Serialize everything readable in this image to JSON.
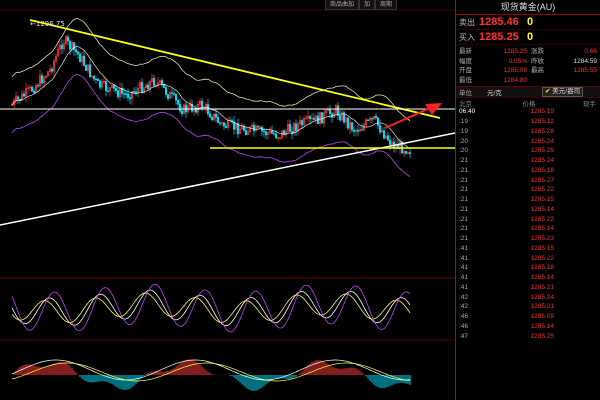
{
  "toolbar": {
    "btn1": "商品曲加",
    "btn2": "加",
    "btn3": "周期"
  },
  "chart": {
    "high_label": "1296.75",
    "colors": {
      "up": "#ff3b3b",
      "down": "#00e0ff",
      "resistance": "#ffff00",
      "support": "#ffffff",
      "arrow": "#ff2020",
      "bb": "#e0e0a0",
      "bb_mid": "#ffffff",
      "bb_low": "#c040ff"
    }
  },
  "panel": {
    "title": "现货黄金(AU)",
    "sell_label": "卖出",
    "sell_price": "1285.46",
    "sell_qty": "0",
    "buy_label": "买入",
    "buy_price": "1285.25",
    "buy_qty": "0",
    "stats": [
      {
        "k": "最新",
        "v": "1285.25",
        "k2": "涨跌",
        "v2": "0.66"
      },
      {
        "k": "幅度",
        "v": "0.05%",
        "k2": "昨收",
        "v2": "1284.59"
      },
      {
        "k": "开盘",
        "v": "1285.08",
        "k2": "最高",
        "v2": "1285.55"
      },
      {
        "k": "最低",
        "v": "1284.80",
        "k2": "",
        "v2": ""
      }
    ],
    "unit_label": "单位",
    "unit_value": "元/克",
    "unit_toggle": "美元/盎司",
    "col_time": "北京",
    "col_price": "价格",
    "col_vol": "现手",
    "ticks": [
      {
        "t": "06:40",
        "p": "1285.19"
      },
      {
        "t": ":19",
        "p": "1285.12"
      },
      {
        "t": ":19",
        "p": "1285.28"
      },
      {
        "t": ":20",
        "p": "1285.24"
      },
      {
        "t": ":20",
        "p": "1285.29"
      },
      {
        "t": ":21",
        "p": "1285.24"
      },
      {
        "t": ":21",
        "p": "1285.18"
      },
      {
        "t": ":21",
        "p": "1285.27"
      },
      {
        "t": ":21",
        "p": "1285.22"
      },
      {
        "t": ":21",
        "p": "1285.15"
      },
      {
        "t": ":21",
        "p": "1285.14"
      },
      {
        "t": ":21",
        "p": "1285.22"
      },
      {
        "t": ":21",
        "p": "1285.14"
      },
      {
        "t": ":21",
        "p": "1285.23"
      },
      {
        "t": ":41",
        "p": "1285.15"
      },
      {
        "t": ":41",
        "p": "1285.22"
      },
      {
        "t": ":41",
        "p": "1285.18"
      },
      {
        "t": ":41",
        "p": "1285.14"
      },
      {
        "t": ":41",
        "p": "1285.21"
      },
      {
        "t": ":42",
        "p": "1285.24"
      },
      {
        "t": ":42",
        "p": "1285.21"
      },
      {
        "t": ":46",
        "p": "1285.09"
      },
      {
        "t": ":46",
        "p": "1285.14"
      },
      {
        "t": ":47",
        "p": "1285.25"
      }
    ]
  }
}
